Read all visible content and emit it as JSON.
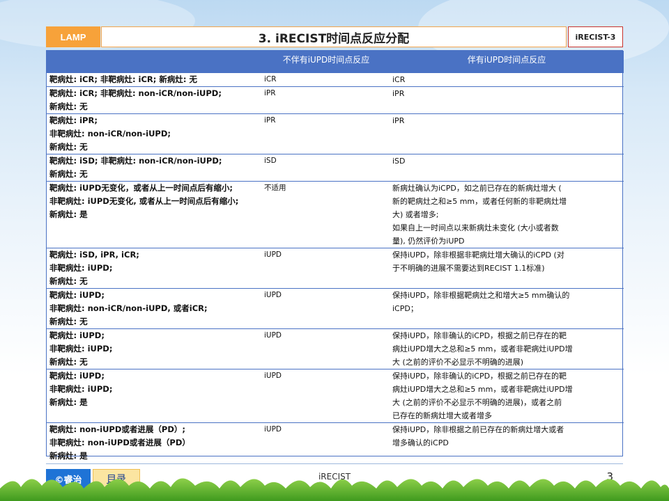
{
  "header": {
    "lamp": "LAMP",
    "title": "3. iRECIST时间点反应分配",
    "code": "iRECIST-3"
  },
  "table": {
    "columns": [
      "",
      "不伴有iUPD时间点反应",
      "伴有iUPD时间点反应"
    ],
    "rows": [
      {
        "c1": [
          "靶病灶: iCR; 非靶病灶: iCR; 新病灶: 无"
        ],
        "c2": [
          "iCR"
        ],
        "c3": [
          "iCR"
        ]
      },
      {
        "c1": [
          "靶病灶: iCR; 非靶病灶: non-iCR/non-iUPD;",
          "新病灶: 无"
        ],
        "c2": [
          "iPR"
        ],
        "c3": [
          "iPR"
        ]
      },
      {
        "c1": [
          "靶病灶: iPR;",
          "非靶病灶: non-iCR/non-iUPD;",
          "新病灶: 无"
        ],
        "c2": [
          "iPR"
        ],
        "c3": [
          "iPR"
        ]
      },
      {
        "c1": [
          "靶病灶: iSD;  非靶病灶: non-iCR/non-iUPD;",
          "新病灶: 无"
        ],
        "c2": [
          "iSD"
        ],
        "c3": [
          "iSD"
        ]
      },
      {
        "c1": [
          "靶病灶: iUPD无变化，或者从上一时间点后有缩小;",
          "非靶病灶: iUPD无变化, 或者从上一时间点后有缩小;",
          "新病灶: 是"
        ],
        "c2": [
          "不适用"
        ],
        "c3": [
          "新病灶确认为iCPD，如之前已存在的新病灶增大 (",
          "新的靶病灶之和≥5 mm，或者任何新的非靶病灶增",
          "大) 或者增多;",
          "如果自上一时间点以来新病灶未变化 (大小或者数",
          "量), 仍然评价为iUPD"
        ]
      },
      {
        "c1": [
          "靶病灶: iSD, iPR, iCR;",
          "非靶病灶: iUPD;",
          "新病灶: 无"
        ],
        "c2": [
          "iUPD"
        ],
        "c3": [
          "保持iUPD，除非根据非靶病灶增大确认的iCPD (对",
          "于不明确的进展不需要达到RECIST 1.1标准)"
        ]
      },
      {
        "c1": [
          "靶病灶: iUPD;",
          "非靶病灶: non-iCR/non-iUPD, 或者iCR;",
          "新病灶: 无"
        ],
        "c2": [
          "iUPD"
        ],
        "c3": [
          "保持iUPD，除非根据靶病灶之和增大≥5 mm确认的",
          "iCPD；"
        ]
      },
      {
        "c1": [
          "靶病灶: iUPD;",
          "非靶病灶: iUPD;",
          "新病灶: 无"
        ],
        "c2": [
          "iUPD"
        ],
        "c3": [
          "保持iUPD，除非确认的iCPD，根据之前已存在的靶",
          "病灶iUPD增大之总和≥5 mm，或者非靶病灶iUPD增",
          "大 (之前的评价不必显示不明确的进展)"
        ]
      },
      {
        "c1": [
          "靶病灶: iUPD;",
          "非靶病灶: iUPD;",
          "新病灶: 是"
        ],
        "c2": [
          "iUPD"
        ],
        "c3": [
          "保持iUPD，除非确认的iCPD，根据之前已存在的靶",
          "病灶iUPD增大之总和≥5 mm，或者非靶病灶iUPD增",
          "大 (之前的评价不必显示不明确的进展)，或者之前",
          "已存在的新病灶增大或者增多"
        ]
      },
      {
        "c1": [
          "靶病灶: non-iUPD或者进展（PD）;",
          "非靶病灶: non-iUPD或者进展（PD）",
          "新病灶: 是"
        ],
        "c2": [
          "iUPD"
        ],
        "c3": [
          "保持iUPD，除非根据之前已存在的新病灶增大或者",
          "增多确认的iCPD"
        ]
      }
    ]
  },
  "footer": {
    "brand": "©睿治",
    "toc_label": "目录",
    "center_text": "iRECIST",
    "page_number": "3"
  },
  "colors": {
    "header_blue": "#4a72c4",
    "lamp_orange": "#f7a23a",
    "brand_blue": "#1f73d6",
    "toc_yellow": "#fbe5a1"
  }
}
